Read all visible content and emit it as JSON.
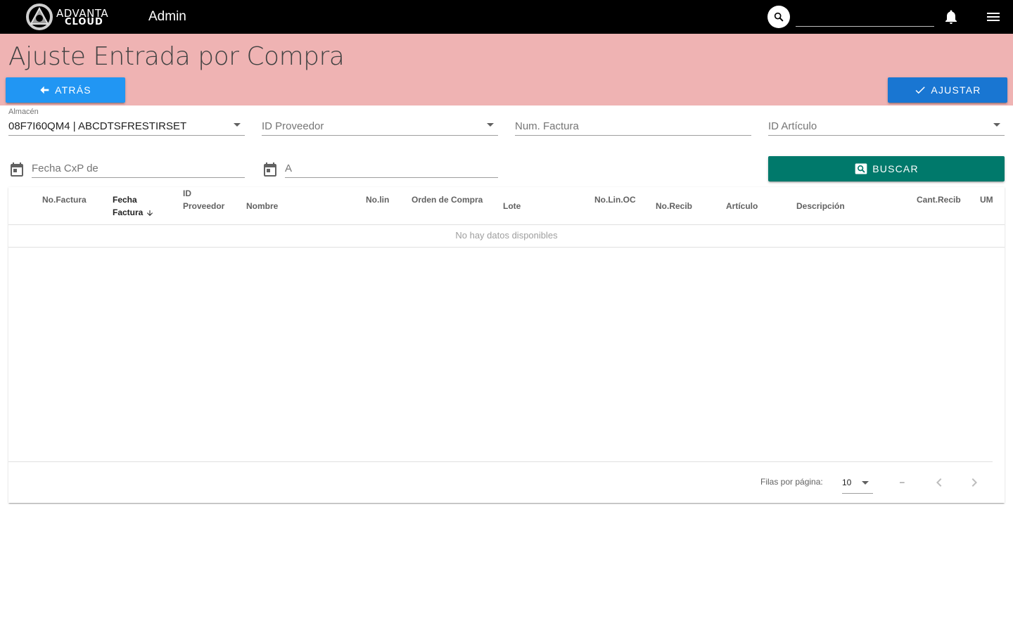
{
  "topbar": {
    "logo_line1": "ADVANTA",
    "logo_line2": "CLOUD",
    "title": "Admin",
    "search_value": ""
  },
  "header": {
    "title": "Ajuste Entrada por Compra",
    "back_label": "ATRÁS",
    "adjust_label": "AJUSTAR"
  },
  "filters": {
    "almacen_label": "Almacén",
    "almacen_value": "08F7I60QM4 | ABCDTSFRESTIRSET",
    "proveedor_placeholder": "ID Proveedor",
    "factura_placeholder": "Num. Factura",
    "articulo_placeholder": "ID Artículo",
    "fecha_de_placeholder": "Fecha CxP de",
    "fecha_a_placeholder": "A",
    "search_label": "BUSCAR"
  },
  "table": {
    "columns": [
      {
        "l1": "No.Factura",
        "l2": ""
      },
      {
        "l1": "Fecha",
        "l2": "Factura"
      },
      {
        "l1": "ID",
        "l2": "Proveedor"
      },
      {
        "l1": "Nombre",
        "l2": ""
      },
      {
        "l1": "No.lin",
        "l2": ""
      },
      {
        "l1": "Orden de Compra",
        "l2": ""
      },
      {
        "l1": "Lote",
        "l2": ""
      },
      {
        "l1": "No.Lin.OC",
        "l2": ""
      },
      {
        "l1": "No.Recib",
        "l2": ""
      },
      {
        "l1": "Artículo",
        "l2": ""
      },
      {
        "l1": "Descripción",
        "l2": ""
      },
      {
        "l1": "Cant.Recib",
        "l2": ""
      },
      {
        "l1": "UM",
        "l2": ""
      }
    ],
    "empty_text": "No hay datos disponibles",
    "rows_per_page_label": "Filas por página:",
    "rows_per_page": "10",
    "range_text": "–"
  },
  "colors": {
    "topbar": "#000000",
    "header_band": "#efb3b3",
    "back_button": "#2196f3",
    "adjust_button": "#1976d2",
    "search_button": "#00796b"
  },
  "icons": [
    "search-icon",
    "bell-icon",
    "menu-icon",
    "arrow-left-icon",
    "check-icon",
    "calendar-icon",
    "image-search-icon",
    "arrow-down-icon",
    "chevron-left-icon",
    "chevron-right-icon"
  ]
}
